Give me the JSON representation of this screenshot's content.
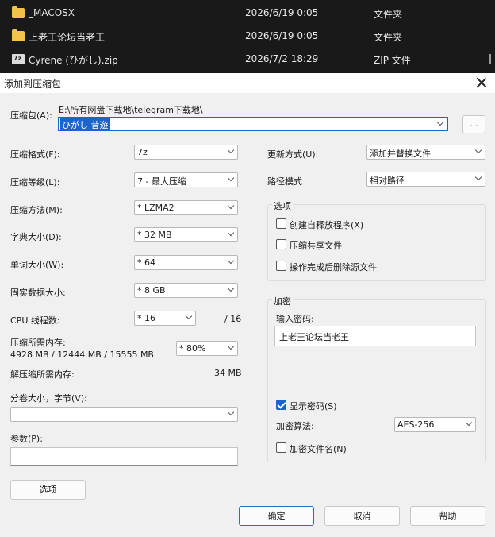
{
  "explorer": {
    "rows": [
      {
        "icon": "folder-icon",
        "name": "_MACOSX",
        "date": "2026/6/19 0:05",
        "type": "文件夹"
      },
      {
        "icon": "folder-icon",
        "name": "上老王论坛当老王",
        "date": "2026/6/19 0:05",
        "type": "文件夹"
      },
      {
        "icon": "zip-file-icon",
        "name": "Cyrene (ひがし).zip",
        "date": "2026/7/2 18:29",
        "type": "ZIP 文件"
      }
    ]
  },
  "dialog": {
    "title": "添加到压缩包",
    "archive": {
      "label": "压缩包(A):",
      "path": "E:\\所有网盘下载地\\telegram下载地\\",
      "name": "ひがし 昔遊",
      "browse_label": "..."
    },
    "left": {
      "format": {
        "label": "压缩格式(F):",
        "value": "7z"
      },
      "level": {
        "label": "压缩等级(L):",
        "value": "7 - 最大压缩"
      },
      "method": {
        "label": "压缩方法(M):",
        "value": "* LZMA2"
      },
      "dict": {
        "label": "字典大小(D):",
        "value": "* 32 MB"
      },
      "word": {
        "label": "单词大小(W):",
        "value": "* 64"
      },
      "solid": {
        "label": "固实数据大小:",
        "value": "* 8 GB"
      },
      "threads": {
        "label": "CPU 线程数:",
        "value": "* 16",
        "total": "/ 16"
      },
      "memory": {
        "label": "压缩所需内存:",
        "detail": "4928 MB / 12444 MB / 15555 MB",
        "value": "* 80%"
      },
      "decompress": {
        "label": "解压缩所需内存:",
        "value": "34 MB"
      },
      "split": {
        "label": "分卷大小，字节(V):",
        "value": ""
      },
      "params": {
        "label": "参数(P):",
        "value": ""
      },
      "options_button": "选项"
    },
    "right": {
      "update": {
        "label": "更新方式(U):",
        "value": "添加并替换文件"
      },
      "path_mode": {
        "label": "路径模式",
        "value": "相对路径"
      },
      "options_group": {
        "title": "选项",
        "sfx": {
          "label": "创建自释放程序(X)",
          "checked": false
        },
        "shared": {
          "label": "压缩共享文件",
          "checked": false
        },
        "delete": {
          "label": "操作完成后删除源文件",
          "checked": false
        }
      },
      "encryption": {
        "title": "加密",
        "password_label": "输入密码:",
        "password": "上老王论坛当老王",
        "show_password": {
          "label": "显示密码(S)",
          "checked": true
        },
        "method_label": "加密算法:",
        "method": "AES-256",
        "encrypt_names": {
          "label": "加密文件名(N)",
          "checked": false
        }
      }
    },
    "buttons": {
      "ok": "确定",
      "cancel": "取消",
      "help": "帮助"
    },
    "accent_color": "#1a64d0"
  }
}
